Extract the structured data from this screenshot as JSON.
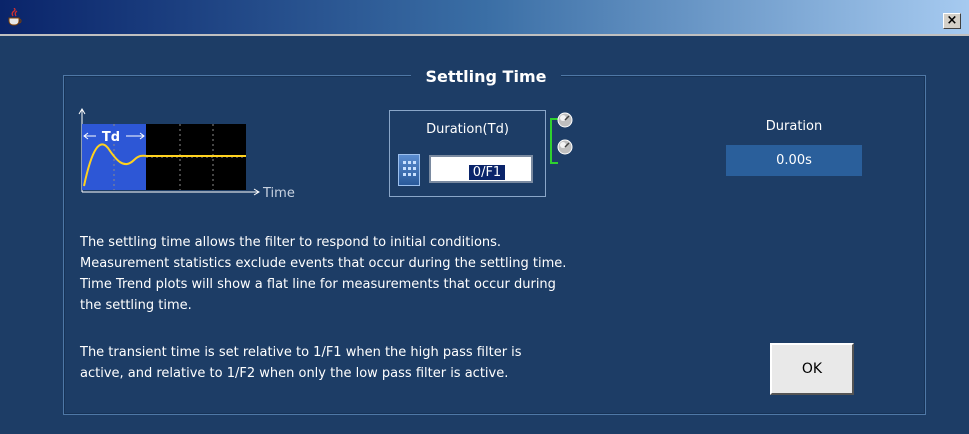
{
  "window": {
    "close_label": "×"
  },
  "panel": {
    "title": "Settling Time",
    "diagram": {
      "td_label": "Td",
      "time_label": "Time"
    }
  },
  "duration_control": {
    "label": "Duration(Td)",
    "value": "0/F1"
  },
  "duration_display": {
    "label": "Duration",
    "value": "0.00s"
  },
  "description": {
    "paragraph1_lines": [
      "The settling time allows the filter to respond to initial conditions.",
      "Measurement statistics exclude events that occur during the settling time.",
      "Time Trend plots will show a flat line for measurements that occur during",
      "the settling time."
    ],
    "paragraph2_lines": [
      "The transient time is set relative to 1/F1 when the high pass filter is",
      "active, and relative to 1/F2 when only the low pass filter is active."
    ]
  },
  "buttons": {
    "ok_label": "OK"
  },
  "colors": {
    "background": "#1d3d66",
    "accent_green": "#2fd12f",
    "signal_yellow": "#ffd21e",
    "value_box": "#2a5f9b"
  }
}
